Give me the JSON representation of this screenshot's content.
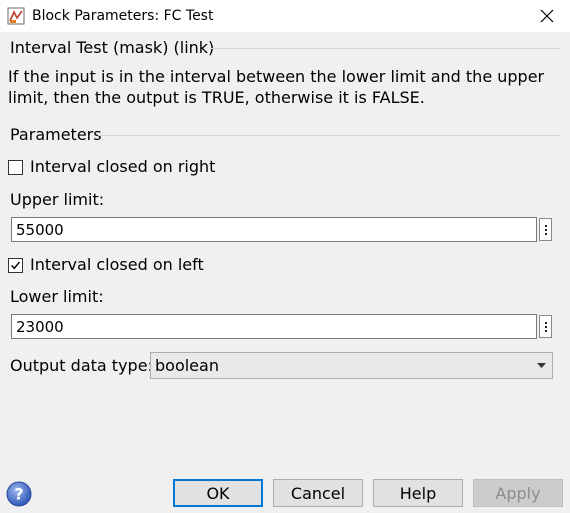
{
  "window": {
    "title": "Block Parameters: FC Test"
  },
  "block": {
    "heading": "Interval Test (mask) (link)",
    "description": "If the input is in the interval between the lower limit and the upper limit, then the output is TRUE, otherwise it is FALSE."
  },
  "parameters": {
    "heading": "Parameters",
    "closed_right": {
      "label": "Interval closed on right",
      "checked": false
    },
    "upper_limit": {
      "label": "Upper limit:",
      "value": "55000"
    },
    "closed_left": {
      "label": "Interval closed on left",
      "checked": true
    },
    "lower_limit": {
      "label": "Lower limit:",
      "value": "23000"
    },
    "output_type": {
      "label": "Output data type:",
      "value": "boolean"
    }
  },
  "buttons": {
    "ok": "OK",
    "cancel": "Cancel",
    "help": "Help",
    "apply": "Apply"
  },
  "icons": {
    "app": "simulink-block-icon",
    "close": "close-icon",
    "help": "help-question-icon",
    "more": "vertical-dots-icon",
    "dropdown": "chevron-down-icon",
    "check": "checkmark-icon"
  },
  "colors": {
    "accent": "#0078d7",
    "background": "#f0f0f0",
    "titlebar": "#ffffff"
  }
}
